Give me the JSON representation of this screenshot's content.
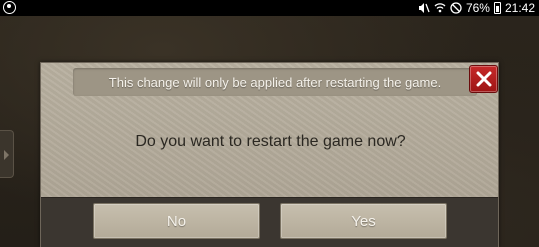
{
  "status_bar": {
    "battery": "76%",
    "time": "21:42"
  },
  "dialog": {
    "notice": "This change will only be applied after restarting the game.",
    "question": "Do you want to restart the game now?",
    "no_label": "No",
    "yes_label": "Yes",
    "close_icon": "close-x-icon"
  },
  "colors": {
    "close_button": "#b51f1f",
    "dialog_panel": "#b3aa9b",
    "footer": "#3b3630"
  }
}
